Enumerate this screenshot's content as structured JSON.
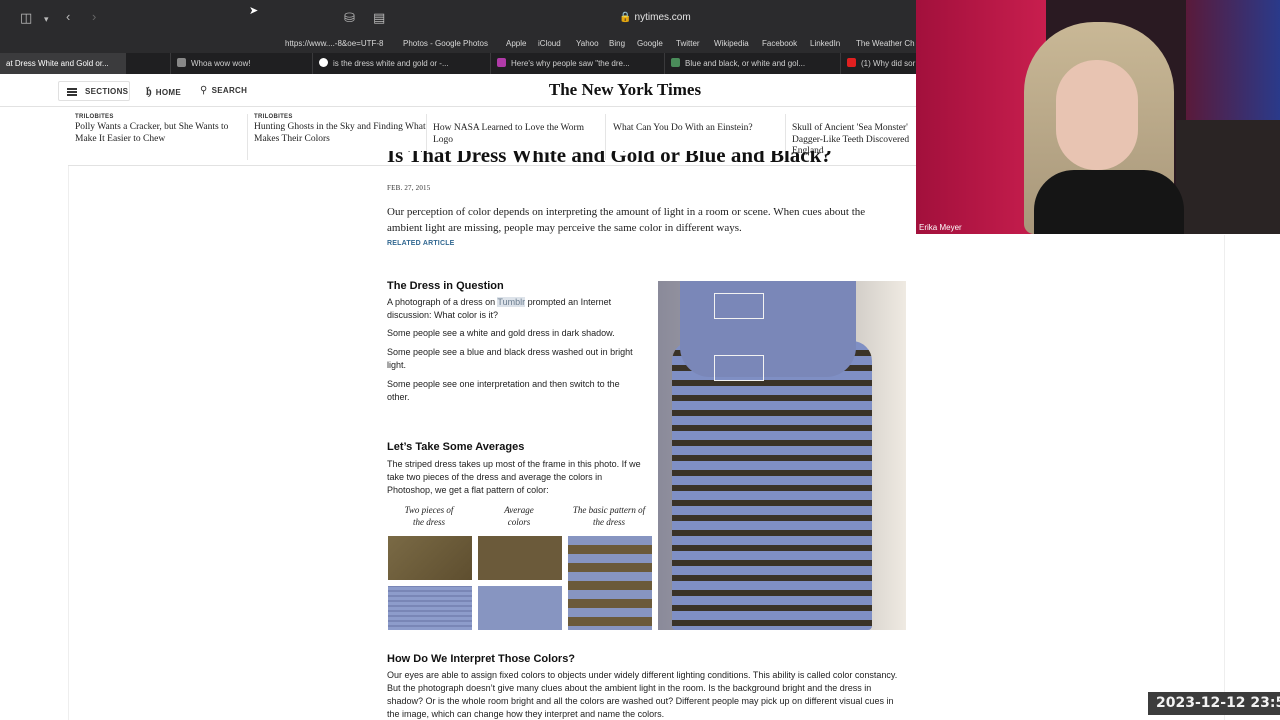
{
  "browser": {
    "url": "nytimes.com",
    "bookmarks": [
      "https://www....-8&oe=UTF-8",
      "Photos - Google Photos",
      "Apple",
      "iCloud",
      "Yahoo",
      "Bing",
      "Google",
      "Twitter",
      "Wikipedia",
      "Facebook",
      "LinkedIn",
      "The Weather Ch"
    ],
    "tabs": [
      {
        "label": "at Dress White and Gold or...",
        "active": true
      },
      {
        "label": "Whoa wow wow!",
        "active": false
      },
      {
        "label": "is the dress white and gold or -...",
        "active": false
      },
      {
        "label": "Here's why people saw \"the dre...",
        "active": false
      },
      {
        "label": "Blue and black, or white and gol...",
        "active": false
      },
      {
        "label": "(1) Why did sor",
        "active": false
      }
    ]
  },
  "nyt": {
    "nav": {
      "sections": "SECTIONS",
      "home": "HOME",
      "search": "SEARCH"
    },
    "masthead": "The New York Times",
    "trilobites": [
      {
        "kicker": "TRILOBITES",
        "headline": "Polly Wants a Cracker, but She Wants to Make It Easier to Chew"
      },
      {
        "kicker": "TRILOBITES",
        "headline": "Hunting Ghosts in the Sky and Finding What Makes Their Colors"
      },
      {
        "kicker": "",
        "headline": "How NASA Learned to Love the Worm Logo"
      },
      {
        "kicker": "",
        "headline": "What Can You Do With an Einstein?"
      },
      {
        "kicker": "",
        "headline": "Skull of Ancient 'Sea Monster' Dagger-Like Teeth Discovered England"
      }
    ]
  },
  "article": {
    "headline": "Is That Dress White and Gold or Blue and Black?",
    "date": "FEB. 27, 2015",
    "summary": "Our perception of color depends on interpreting the amount of light in a room or scene. When cues about the ambient light are missing, people may perceive the same color in different ways.",
    "related": "RELATED ARTICLE",
    "section1": {
      "title": "The Dress in Question",
      "p1_pre": "A photograph of a dress on ",
      "p1_link": "Tumblr",
      "p1_post": " prompted an Internet discussion: What color is it?",
      "p2": "Some people see a white and gold dress in dark shadow.",
      "p3": "Some people see a blue and black dress washed out in bright light.",
      "p4": "Some people see one interpretation and then switch to the other."
    },
    "section2": {
      "title": "Let’s Take Some Averages",
      "body": "The striped dress takes up most of the frame in this photo. If we take two pieces of the dress and average the colors in Photoshop, we get a flat pattern of color:",
      "captions": [
        "Two pieces of the dress",
        "Average colors",
        "The basic pattern of the dress"
      ]
    },
    "section3": {
      "title": "How Do We Interpret Those Colors?",
      "body": "Our eyes are able to assign fixed colors to objects under widely different lighting conditions. This ability is called color constancy. But the photograph doesn’t give many clues about the ambient light in the room. Is the background bright and the dress in shadow? Or is the whole room bright and all the colors are washed out? Different people may pick up on different visual cues in the image, which can change how they interpret and name the colors."
    }
  },
  "colors": {
    "gold": "#6b5a3a",
    "blue": "#8795c1",
    "link": "#326891"
  },
  "webcam": {
    "name": "Erika Meyer",
    "timestamp": "2023-12-12 23:5"
  }
}
